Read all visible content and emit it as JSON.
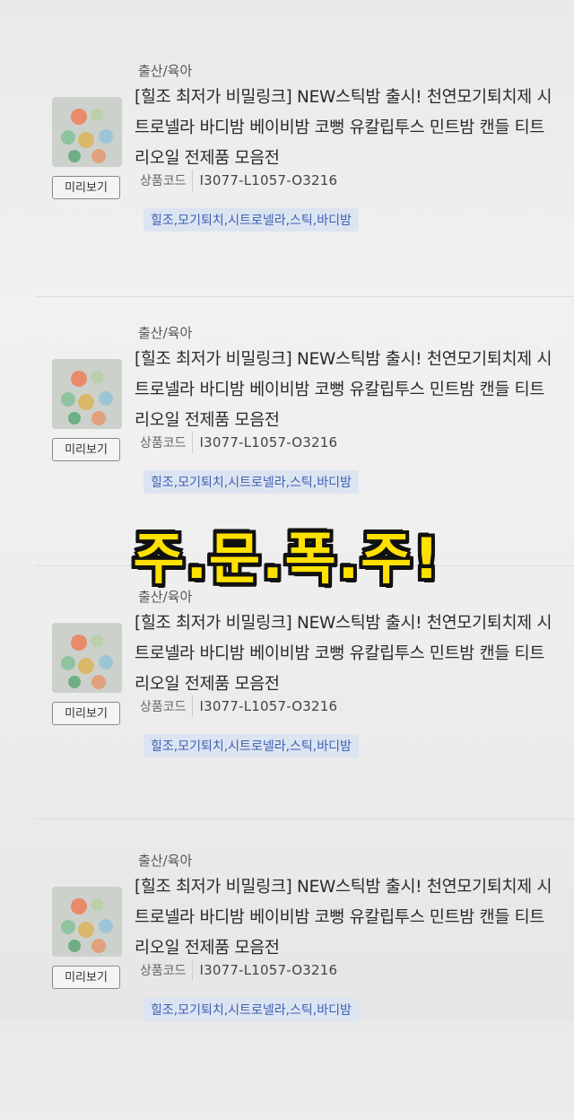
{
  "products": [
    {
      "category": "출산/육아",
      "title": "[힐조 최저가 비밀링크] NEW스틱밤 출시! 천연모기퇴치제 시트로넬라 바디밤 베이비밤 코뻥 유칼립투스 민트밤 캔들 티트리오일 전제품 모음전",
      "preview_label": "미리보기",
      "code_label": "상품코드",
      "code_value": "I3077-L1057-O3216",
      "tags": "힐조,모기퇴치,시트로넬라,스틱,바디밤"
    },
    {
      "category": "출산/육아",
      "title": "[힐조 최저가 비밀링크] NEW스틱밤 출시! 천연모기퇴치제 시트로넬라 바디밤 베이비밤 코뻥 유칼립투스 민트밤 캔들 티트리오일 전제품 모음전",
      "preview_label": "미리보기",
      "code_label": "상품코드",
      "code_value": "I3077-L1057-O3216",
      "tags": "힐조,모기퇴치,시트로넬라,스틱,바디밤"
    },
    {
      "category": "출산/육아",
      "title": "[힐조 최저가 비밀링크] NEW스틱밤 출시! 천연모기퇴치제 시트로넬라 바디밤 베이비밤 코뻥 유칼립투스 민트밤 캔들 티트리오일 전제품 모음전",
      "preview_label": "미리보기",
      "code_label": "상품코드",
      "code_value": "I3077-L1057-O3216",
      "tags": "힐조,모기퇴치,시트로넬라,스틱,바디밤"
    },
    {
      "category": "출산/육아",
      "title": "[힐조 최저가 비밀링크] NEW스틱밤 출시! 천연모기퇴치제 시트로넬라 바디밤 베이비밤 코뻥 유칼립투스 민트밤 캔들 티트리오일 전제품 모음전",
      "preview_label": "미리보기",
      "code_label": "상품코드",
      "code_value": "I3077-L1057-O3216",
      "tags": "힐조,모기퇴치,시트로넬라,스틱,바디밤"
    }
  ],
  "overlay_caption": "주.문.폭.주!",
  "colors": {
    "overlay_text": "#ffe100",
    "overlay_outline": "#111111",
    "tag_text": "#3b62b4",
    "tag_bg": "#dde4f1"
  }
}
